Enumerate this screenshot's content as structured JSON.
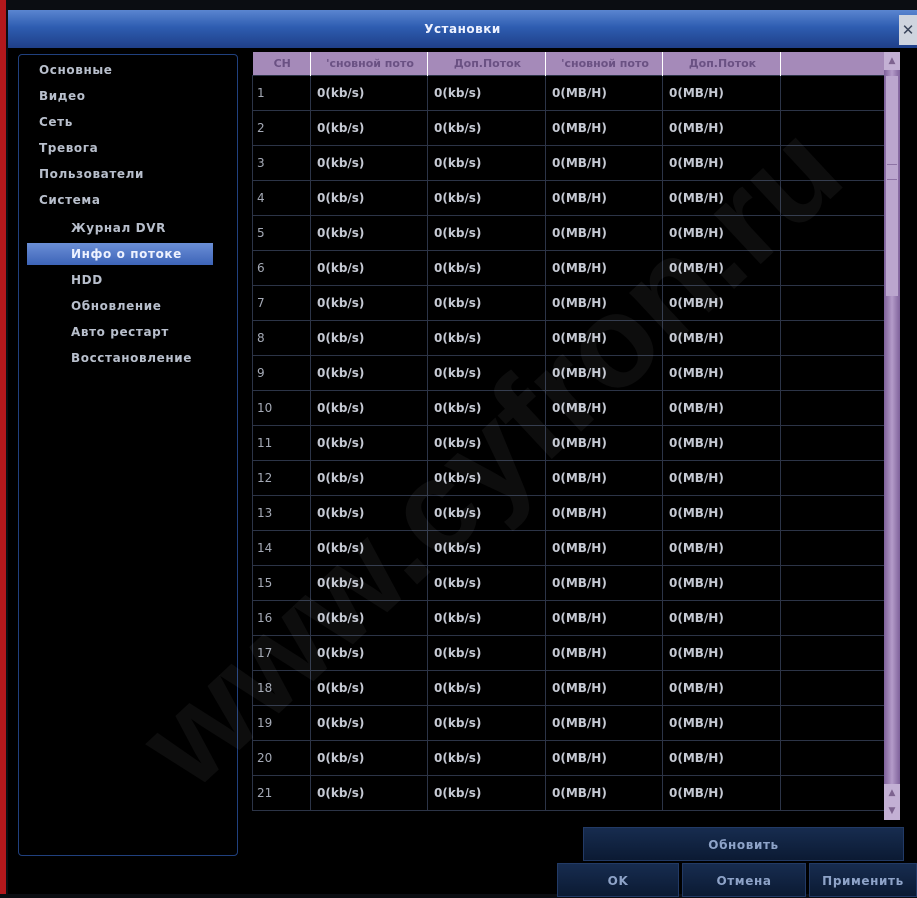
{
  "window": {
    "title": "Установки",
    "close_glyph": "✕"
  },
  "sidebar": {
    "items": [
      {
        "label": "Основные",
        "level": 0
      },
      {
        "label": "Видео",
        "level": 0
      },
      {
        "label": "Сеть",
        "level": 0
      },
      {
        "label": "Тревога",
        "level": 0
      },
      {
        "label": "Пользователи",
        "level": 0
      },
      {
        "label": "Система",
        "level": 0
      },
      {
        "label": "Журнал DVR",
        "level": 1
      },
      {
        "label": "Инфо о потоке",
        "level": 1,
        "active": true
      },
      {
        "label": "HDD",
        "level": 1
      },
      {
        "label": "Обновление",
        "level": 1
      },
      {
        "label": "Авто рестарт",
        "level": 1
      },
      {
        "label": "Восстановление",
        "level": 1
      }
    ]
  },
  "table": {
    "columns": [
      "CH",
      "'сновной пото",
      "Доп.Поток",
      "'сновной пото",
      "Доп.Поток",
      ""
    ],
    "rows": [
      [
        "1",
        "0(kb/s)",
        "0(kb/s)",
        "0(MB/H)",
        "0(MB/H)"
      ],
      [
        "2",
        "0(kb/s)",
        "0(kb/s)",
        "0(MB/H)",
        "0(MB/H)"
      ],
      [
        "3",
        "0(kb/s)",
        "0(kb/s)",
        "0(MB/H)",
        "0(MB/H)"
      ],
      [
        "4",
        "0(kb/s)",
        "0(kb/s)",
        "0(MB/H)",
        "0(MB/H)"
      ],
      [
        "5",
        "0(kb/s)",
        "0(kb/s)",
        "0(MB/H)",
        "0(MB/H)"
      ],
      [
        "6",
        "0(kb/s)",
        "0(kb/s)",
        "0(MB/H)",
        "0(MB/H)"
      ],
      [
        "7",
        "0(kb/s)",
        "0(kb/s)",
        "0(MB/H)",
        "0(MB/H)"
      ],
      [
        "8",
        "0(kb/s)",
        "0(kb/s)",
        "0(MB/H)",
        "0(MB/H)"
      ],
      [
        "9",
        "0(kb/s)",
        "0(kb/s)",
        "0(MB/H)",
        "0(MB/H)"
      ],
      [
        "10",
        "0(kb/s)",
        "0(kb/s)",
        "0(MB/H)",
        "0(MB/H)"
      ],
      [
        "11",
        "0(kb/s)",
        "0(kb/s)",
        "0(MB/H)",
        "0(MB/H)"
      ],
      [
        "12",
        "0(kb/s)",
        "0(kb/s)",
        "0(MB/H)",
        "0(MB/H)"
      ],
      [
        "13",
        "0(kb/s)",
        "0(kb/s)",
        "0(MB/H)",
        "0(MB/H)"
      ],
      [
        "14",
        "0(kb/s)",
        "0(kb/s)",
        "0(MB/H)",
        "0(MB/H)"
      ],
      [
        "15",
        "0(kb/s)",
        "0(kb/s)",
        "0(MB/H)",
        "0(MB/H)"
      ],
      [
        "16",
        "0(kb/s)",
        "0(kb/s)",
        "0(MB/H)",
        "0(MB/H)"
      ],
      [
        "17",
        "0(kb/s)",
        "0(kb/s)",
        "0(MB/H)",
        "0(MB/H)"
      ],
      [
        "18",
        "0(kb/s)",
        "0(kb/s)",
        "0(MB/H)",
        "0(MB/H)"
      ],
      [
        "19",
        "0(kb/s)",
        "0(kb/s)",
        "0(MB/H)",
        "0(MB/H)"
      ],
      [
        "20",
        "0(kb/s)",
        "0(kb/s)",
        "0(MB/H)",
        "0(MB/H)"
      ],
      [
        "21",
        "0(kb/s)",
        "0(kb/s)",
        "0(MB/H)",
        "0(MB/H)"
      ]
    ]
  },
  "buttons": {
    "refresh": "Обновить",
    "ok": "OK",
    "cancel": "Отмена",
    "apply": "Применить"
  },
  "watermark": "www.cyfron.ru",
  "icons": {
    "close": "close-icon",
    "scroll_up": "scroll-up-icon",
    "scroll_down": "scroll-down-icon"
  },
  "colors": {
    "title_bar": "#2e5db1",
    "header": "#a58ab9",
    "active_item": "#4f75c4",
    "scrollbar": "#9b7fb2"
  }
}
